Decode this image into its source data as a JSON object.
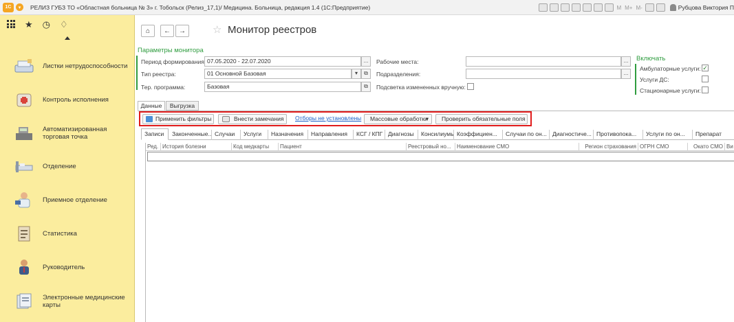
{
  "titlebar": {
    "logo": "1С",
    "title": "РЕЛИЗ ГУБЗ ТО «Областная больница № 3» г. Тобольск (Релиз_17,1)/  Медицина. Больница, редакция 1.4  (1С:Предприятие)",
    "m_buttons": [
      "M",
      "M+",
      "M-"
    ],
    "user": "Рубцова Виктория П"
  },
  "sidebar": {
    "items": [
      {
        "label": "Листки нетрудоспособности",
        "icon": "sick-leave-icon"
      },
      {
        "label": "Контроль исполнения",
        "icon": "first-aid-icon"
      },
      {
        "label": "Автоматизированная торговая точка",
        "icon": "cash-register-icon"
      },
      {
        "label": "Отделение",
        "icon": "ward-bed-icon"
      },
      {
        "label": "Приемное отделение",
        "icon": "doctor-icon"
      },
      {
        "label": "Статистика",
        "icon": "clipboard-icon"
      },
      {
        "label": "Руководитель",
        "icon": "manager-icon"
      },
      {
        "label": "Электронные медицинские карты",
        "icon": "medical-cards-icon"
      }
    ]
  },
  "page": {
    "title": "Монитор реестров"
  },
  "params": {
    "section_title": "Параметры монитора",
    "period_label": "Период формирования:",
    "period_value": "07.05.2020 - 22.07.2020",
    "registry_type_label": "Тип реестра:",
    "registry_type_value": "01 Основной Базовая",
    "program_label": "Тер. программа:",
    "program_value": "Базовая",
    "workplaces_label": "Рабочие места:",
    "departments_label": "Подразделения:",
    "highlight_label": "Подсветка измененных вручную:",
    "ellipsis": "..."
  },
  "include": {
    "title": "Включать",
    "ambulatory_label": "Амбулаторные услуги:",
    "ambulatory_checked": true,
    "ds_label": "Услуги ДС:",
    "ds_checked": false,
    "inpatient_label": "Стационарные услуги:",
    "inpatient_checked": false
  },
  "tabs": [
    "Данные",
    "Выгрузка"
  ],
  "toolbar": {
    "apply_filters": "Применить фильтры",
    "add_remarks": "Внести замечания",
    "filters_link": "Отборы не установлены",
    "mass_processing": "Массовые обработки",
    "check_fields": "Проверить обязательные поля"
  },
  "subtabs": [
    "Записи",
    "Законченные...",
    "Случаи",
    "Услуги",
    "Назначения",
    "Направления",
    "КСГ / КПГ",
    "Диагнозы",
    "Консилиумы",
    "Коэффициен...",
    "Случаи по он...",
    "Диагностиче...",
    "Противопока...",
    "Услуги по он...",
    "Препарат"
  ],
  "table": {
    "columns": [
      "Ред.",
      "История болезни",
      "Код медкарты",
      "Пациент",
      "Реестровый но...",
      "Наименование СМО",
      "Регион страхования",
      "ОГРН СМО",
      "Окато СМО",
      "Ви"
    ]
  }
}
